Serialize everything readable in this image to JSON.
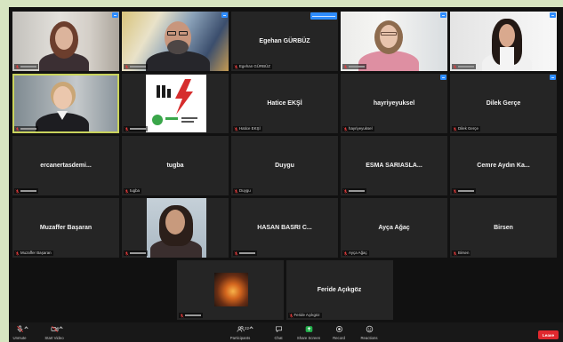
{
  "colors": {
    "frame_bg": "#d7e5c1",
    "more_button_blue": "#2d8cff",
    "speaker_highlight": "#c9d35c",
    "muted_red": "#e23b3b",
    "leave_red": "#e0282e",
    "share_green": "#23b14d"
  },
  "gallery": {
    "tiles": [
      {
        "more_button": true,
        "mic_icon": "microphone-muted"
      },
      {
        "more_button": true,
        "mic_icon": "microphone-muted"
      },
      {
        "display_name": "Egehan GÜRBÜZ",
        "label": "Egehan GÜRBÜZ",
        "more_button": true,
        "mic_icon": "microphone-muted"
      },
      {
        "more_button": true,
        "mic_icon": "microphone-muted"
      },
      {
        "more_button": true,
        "mic_icon": "microphone-muted"
      },
      {
        "active_speaker": true,
        "mic_icon": "microphone-muted"
      },
      {
        "mic_icon": "microphone-muted"
      },
      {
        "display_name": "Hatice EKŞİ",
        "label": "Hatice EKŞİ",
        "mic_icon": "microphone-muted"
      },
      {
        "display_name": "hayriyeyuksel",
        "label": "hayriyeyuksel",
        "more_button": true,
        "mic_icon": "microphone-muted"
      },
      {
        "display_name": "Dilek Gerçe",
        "label": "Dilek Gerçe",
        "more_button": true,
        "mic_icon": "microphone-muted"
      },
      {
        "display_name": "ercanertasdemi...",
        "mic_icon": "microphone-muted"
      },
      {
        "display_name": "tugba",
        "label": "tugba",
        "mic_icon": "microphone-muted"
      },
      {
        "display_name": "Duygu",
        "label": "Duygu",
        "mic_icon": "microphone-muted"
      },
      {
        "display_name": "ESMA SARIASLA...",
        "mic_icon": "microphone-muted"
      },
      {
        "display_name": "Cemre Aydın Ka...",
        "mic_icon": "microphone-muted"
      },
      {
        "display_name": "Muzaffer Başaran",
        "label": "Muzaffer Başaran",
        "mic_icon": "microphone-muted"
      },
      {
        "mic_icon": "microphone-muted"
      },
      {
        "display_name": "HASAN BASRI C...",
        "mic_icon": "microphone-muted"
      },
      {
        "display_name": "Ayça Ağaç",
        "label": "Ayça Ağaç",
        "mic_icon": "microphone-muted"
      },
      {
        "display_name": "Birsen",
        "label": "Birsen",
        "mic_icon": "microphone-muted"
      },
      {
        "mic_icon": "microphone-muted"
      },
      {
        "display_name": "Feride Açıkgöz",
        "label": "Feride Açıkgöz",
        "mic_icon": "microphone-muted"
      }
    ]
  },
  "toolbar": {
    "unmute": {
      "label": "Unmute",
      "icon": "microphone-muted"
    },
    "start_video": {
      "label": "Start Video",
      "icon": "video-off"
    },
    "participants": {
      "label": "Participants",
      "icon": "people",
      "count": "22"
    },
    "chat": {
      "label": "Chat",
      "icon": "chat-bubble"
    },
    "share_screen": {
      "label": "Share Screen",
      "icon": "share-screen"
    },
    "record": {
      "label": "Record",
      "icon": "record"
    },
    "reactions": {
      "label": "Reactions",
      "icon": "smiley"
    },
    "leave": {
      "label": "Leave"
    }
  }
}
